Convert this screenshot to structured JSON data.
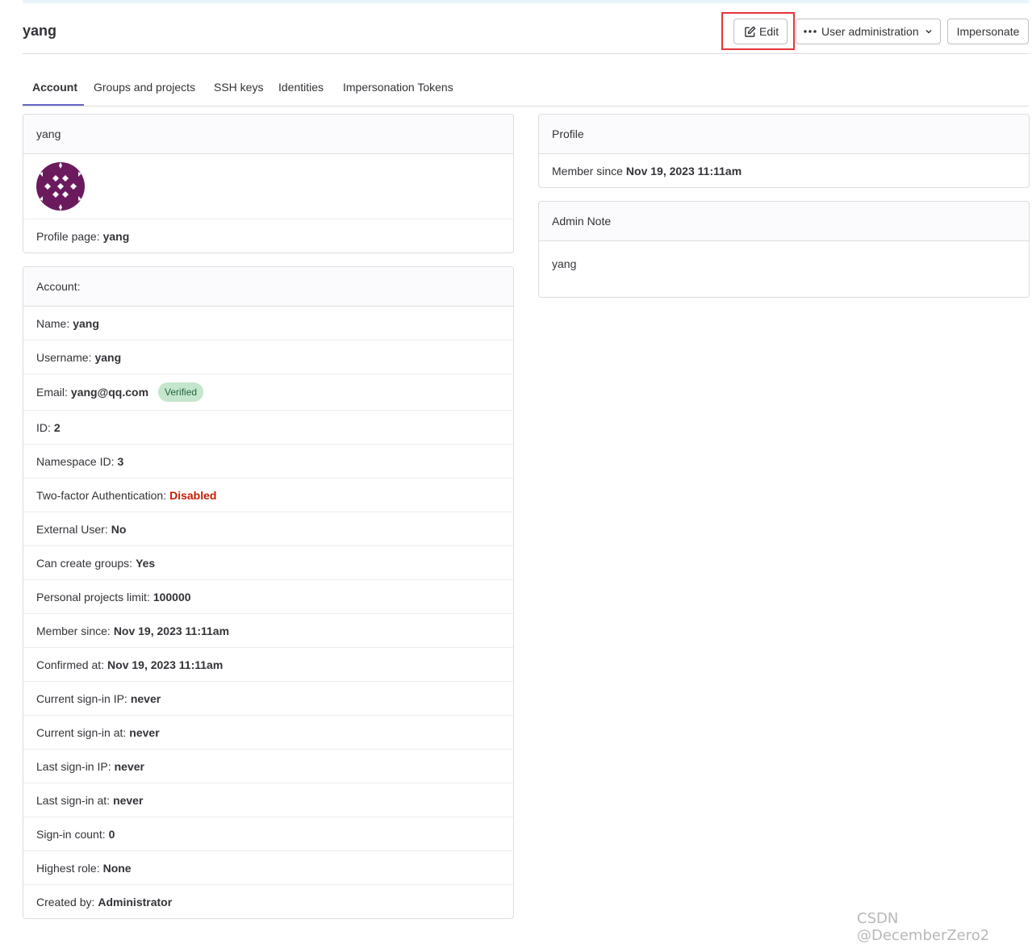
{
  "header": {
    "title": "yang",
    "edit_label": "Edit",
    "admin_menu_label": "User administration",
    "impersonate_label": "Impersonate"
  },
  "tabs": [
    {
      "label": "Account",
      "active": true
    },
    {
      "label": "Groups and projects",
      "active": false
    },
    {
      "label": "SSH keys",
      "active": false
    },
    {
      "label": "Identities",
      "active": false
    },
    {
      "label": "Impersonation Tokens",
      "active": false
    }
  ],
  "user_card": {
    "title": "yang",
    "avatar_color": "#6b1a5e",
    "profile_page_label": "Profile page:",
    "profile_page_value": "yang"
  },
  "account": {
    "title": "Account:",
    "rows": [
      {
        "label": "Name:",
        "value": "yang"
      },
      {
        "label": "Username:",
        "value": "yang"
      },
      {
        "label": "Email:",
        "value": "yang@qq.com",
        "badge": "Verified"
      },
      {
        "label": "ID:",
        "value": "2"
      },
      {
        "label": "Namespace ID:",
        "value": "3"
      },
      {
        "label": "Two-factor Authentication:",
        "value": "Disabled",
        "status": "danger"
      },
      {
        "label": "External User:",
        "value": "No"
      },
      {
        "label": "Can create groups:",
        "value": "Yes"
      },
      {
        "label": "Personal projects limit:",
        "value": "100000"
      },
      {
        "label": "Member since:",
        "value": "Nov 19, 2023 11:11am"
      },
      {
        "label": "Confirmed at:",
        "value": "Nov 19, 2023 11:11am"
      },
      {
        "label": "Current sign-in IP:",
        "value": "never"
      },
      {
        "label": "Current sign-in at:",
        "value": "never"
      },
      {
        "label": "Last sign-in IP:",
        "value": "never"
      },
      {
        "label": "Last sign-in at:",
        "value": "never"
      },
      {
        "label": "Sign-in count:",
        "value": "0"
      },
      {
        "label": "Highest role:",
        "value": "None"
      },
      {
        "label": "Created by:",
        "value": "Administrator"
      }
    ]
  },
  "profile": {
    "title": "Profile",
    "member_since_label": "Member since",
    "member_since_value": "Nov 19, 2023 11:11am"
  },
  "admin_note": {
    "title": "Admin Note",
    "text": "yang"
  },
  "watermark": "CSDN @DecemberZero2",
  "colors": {
    "accent": "#6666c4",
    "danger": "#c91c00",
    "verified_bg": "#c3e6cd",
    "verified_text": "#24663b",
    "highlight": "#e5353b"
  }
}
